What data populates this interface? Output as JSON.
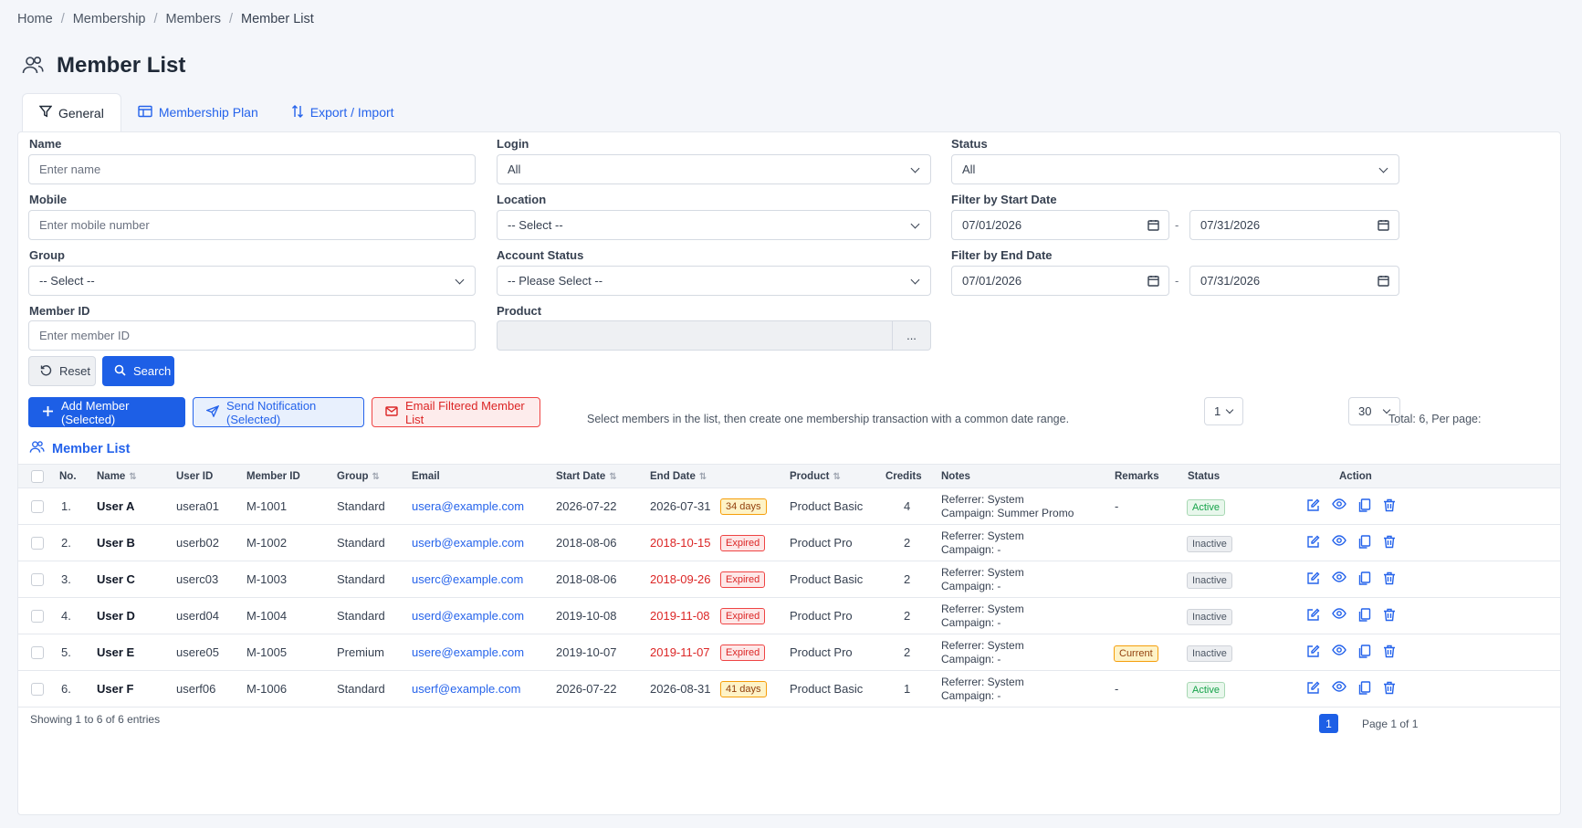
{
  "breadcrumb": [
    "Home",
    "Membership",
    "Members",
    "Member List"
  ],
  "page_title": "Member List",
  "tabs": [
    {
      "label": "General",
      "icon": "filter-icon"
    },
    {
      "label": "Membership Plan",
      "icon": "plan-icon"
    },
    {
      "label": "Export / Import",
      "icon": "sort-arrows-icon"
    }
  ],
  "filters": {
    "name": {
      "label": "Name",
      "placeholder": "Enter name"
    },
    "mobile": {
      "label": "Mobile",
      "placeholder": "Enter mobile number"
    },
    "group": {
      "label": "Group",
      "value": "-- Select --"
    },
    "member_id": {
      "label": "Member ID",
      "placeholder": "Enter member ID"
    },
    "login": {
      "label": "Login",
      "value": "All"
    },
    "location": {
      "label": "Location",
      "value": "-- Select --"
    },
    "account_status": {
      "label": "Account Status",
      "value": "-- Please Select --"
    },
    "product": {
      "label": "Product",
      "value": "",
      "picker": "..."
    },
    "status": {
      "label": "Status",
      "value": "All"
    },
    "start_date": {
      "label": "Filter by Start Date",
      "from": "07/01/2026",
      "to": "07/31/2026",
      "sep": "-"
    },
    "end_date": {
      "label": "Filter by End Date",
      "from": "07/01/2026",
      "to": "07/31/2026",
      "sep": "-"
    }
  },
  "buttons": {
    "reset": "Reset",
    "search": "Search",
    "add_member": "Add Member (Selected)",
    "send_notification": "Send Notification (Selected)",
    "email_filtered": "Email Filtered Member List"
  },
  "hint": "Select members in the list, then create one membership transaction with a common date range.",
  "pagination": {
    "page_select": "1",
    "total_label": "Total: 6, Per page:",
    "per_page": "30",
    "showing": "Showing 1 to 6 of 6 entries",
    "current_page": "1",
    "page_of": "Page 1 of 1"
  },
  "section_title": "Member List",
  "columns": [
    "No.",
    "Name",
    "User ID",
    "Member ID",
    "Group",
    "Email",
    "Start Date",
    "End Date",
    "Product",
    "Credits",
    "Notes",
    "Remarks",
    "Status",
    "Action"
  ],
  "rows": [
    {
      "no": "1.",
      "name": "User A",
      "user_id": "usera01",
      "member_id": "M-1001",
      "group": "Standard",
      "email": "usera@example.com",
      "start": "2026-07-22",
      "end": "2026-07-31",
      "end_badge": "34 days",
      "end_badge_type": "days",
      "end_red": false,
      "product": "Product Basic",
      "credits": "4",
      "notes1": "Referrer: System",
      "notes2": "Campaign: Summer Promo",
      "remarks": "-",
      "remarks_badge": false,
      "status": "Active"
    },
    {
      "no": "2.",
      "name": "User B",
      "user_id": "userb02",
      "member_id": "M-1002",
      "group": "Standard",
      "email": "userb@example.com",
      "start": "2018-08-06",
      "end": "2018-10-15",
      "end_badge": "Expired",
      "end_badge_type": "exp",
      "end_red": true,
      "product": "Product Pro",
      "credits": "2",
      "notes1": "Referrer: System",
      "notes2": "Campaign: -",
      "remarks": "",
      "remarks_badge": false,
      "status": "Inactive"
    },
    {
      "no": "3.",
      "name": "User C",
      "user_id": "userc03",
      "member_id": "M-1003",
      "group": "Standard",
      "email": "userc@example.com",
      "start": "2018-08-06",
      "end": "2018-09-26",
      "end_badge": "Expired",
      "end_badge_type": "exp",
      "end_red": true,
      "product": "Product Basic",
      "credits": "2",
      "notes1": "Referrer: System",
      "notes2": "Campaign: -",
      "remarks": "",
      "remarks_badge": false,
      "status": "Inactive"
    },
    {
      "no": "4.",
      "name": "User D",
      "user_id": "userd04",
      "member_id": "M-1004",
      "group": "Standard",
      "email": "userd@example.com",
      "start": "2019-10-08",
      "end": "2019-11-08",
      "end_badge": "Expired",
      "end_badge_type": "exp",
      "end_red": true,
      "product": "Product Pro",
      "credits": "2",
      "notes1": "Referrer: System",
      "notes2": "Campaign: -",
      "remarks": "",
      "remarks_badge": false,
      "status": "Inactive"
    },
    {
      "no": "5.",
      "name": "User E",
      "user_id": "usere05",
      "member_id": "M-1005",
      "group": "Premium",
      "email": "usere@example.com",
      "start": "2019-10-07",
      "end": "2019-11-07",
      "end_badge": "Expired",
      "end_badge_type": "exp",
      "end_red": true,
      "product": "Product Pro",
      "credits": "2",
      "notes1": "Referrer: System",
      "notes2": "Campaign: -",
      "remarks": "Current",
      "remarks_badge": true,
      "status": "Inactive"
    },
    {
      "no": "6.",
      "name": "User F",
      "user_id": "userf06",
      "member_id": "M-1006",
      "group": "Standard",
      "email": "userf@example.com",
      "start": "2026-07-22",
      "end": "2026-08-31",
      "end_badge": "41 days",
      "end_badge_type": "days",
      "end_red": false,
      "product": "Product Basic",
      "credits": "1",
      "notes1": "Referrer: System",
      "notes2": "Campaign: -",
      "remarks": "-",
      "remarks_badge": false,
      "status": "Active"
    }
  ],
  "colors": {
    "primary": "#1d5fe6",
    "link": "#2563eb",
    "danger": "#dc2626",
    "success": "#16a34a",
    "warning": "#f59e0b"
  }
}
